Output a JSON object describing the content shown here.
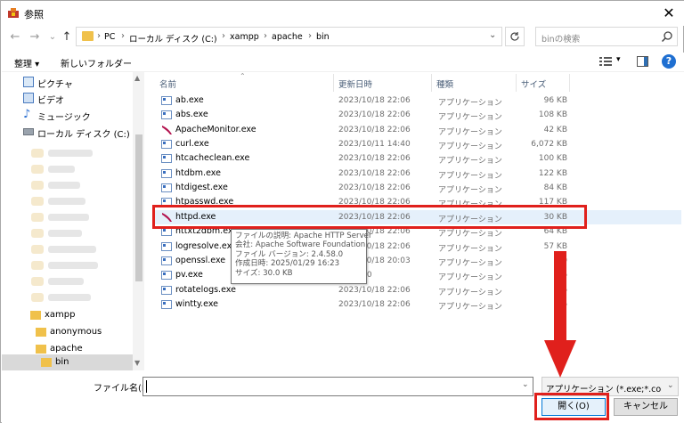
{
  "window": {
    "title": "参照",
    "close_glyph": "✕"
  },
  "nav_buttons": {
    "back": "←",
    "forward": "→",
    "recent": "⌄",
    "up": "↑"
  },
  "address": {
    "crumbs": [
      "PC",
      "ローカル ディスク (C:)",
      "xampp",
      "apache",
      "bin"
    ],
    "separator": "›"
  },
  "search": {
    "placeholder": "binの検索"
  },
  "toolbar": {
    "organize": "整理 ▾",
    "new_folder": "新しいフォルダー",
    "help": "?"
  },
  "sidebar": {
    "items": [
      {
        "label": "ピクチャ",
        "icon": "pictures-icon"
      },
      {
        "label": "ビデオ",
        "icon": "videos-icon"
      },
      {
        "label": "ミュージック",
        "icon": "music-icon"
      },
      {
        "label": "ローカル ディスク (C:)",
        "icon": "drive-icon"
      }
    ],
    "folders": [
      "xampp",
      "anonymous",
      "apache",
      "bin"
    ]
  },
  "columns": {
    "name": "名前",
    "modified": "更新日時",
    "type": "種類",
    "size": "サイズ"
  },
  "files": [
    {
      "name": "ab.exe",
      "date": "2023/10/18 22:06",
      "type": "アプリケーション",
      "size": "96 KB"
    },
    {
      "name": "abs.exe",
      "date": "2023/10/18 22:06",
      "type": "アプリケーション",
      "size": "108 KB"
    },
    {
      "name": "ApacheMonitor.exe",
      "date": "2023/10/18 22:06",
      "type": "アプリケーション",
      "size": "42 KB"
    },
    {
      "name": "curl.exe",
      "date": "2023/10/11 14:40",
      "type": "アプリケーション",
      "size": "6,072 KB"
    },
    {
      "name": "htcacheclean.exe",
      "date": "2023/10/18 22:06",
      "type": "アプリケーション",
      "size": "100 KB"
    },
    {
      "name": "htdbm.exe",
      "date": "2023/10/18 22:06",
      "type": "アプリケーション",
      "size": "122 KB"
    },
    {
      "name": "htdigest.exe",
      "date": "2023/10/18 22:06",
      "type": "アプリケーション",
      "size": "84 KB"
    },
    {
      "name": "htpasswd.exe",
      "date": "2023/10/18 22:06",
      "type": "アプリケーション",
      "size": "117 KB"
    },
    {
      "name": "httpd.exe",
      "date": "2023/10/18 22:06",
      "type": "アプリケーション",
      "size": "30 KB"
    },
    {
      "name": "httxt2dbm.exe",
      "date": "2023/10/18 22:06",
      "type": "アプリケーション",
      "size": "64 KB"
    },
    {
      "name": "logresolve.exe",
      "date": "2023/10/18 22:06",
      "type": "アプリケーション",
      "size": "57 KB"
    },
    {
      "name": "openssl.exe",
      "date": "2023/10/18 20:03",
      "type": "アプリケーション",
      "size": "70"
    },
    {
      "name": "pv.exe",
      "date": "/17 2:30",
      "type": "アプリケーション",
      "size": "6"
    },
    {
      "name": "rotatelogs.exe",
      "date": "2023/10/18 22:06",
      "type": "アプリケーション",
      "size": "6"
    },
    {
      "name": "wintty.exe",
      "date": "2023/10/18 22:06",
      "type": "アプリケーション",
      "size": "6"
    }
  ],
  "tooltip": {
    "lines": [
      "ファイルの説明: Apache HTTP Server",
      "会社: Apache Software Foundation",
      "ファイル バージョン: 2.4.58.0",
      "作成日時: 2025/01/29 16:23",
      "サイズ: 30.0 KB"
    ]
  },
  "bottom": {
    "filename_label": "ファイル名(N):",
    "filename_value": "",
    "filter": "アプリケーション (*.exe;*.com;*.icd",
    "open": "開く(O)",
    "cancel": "キャンセル"
  },
  "colors": {
    "highlight": "#e0201c",
    "selection": "#e5f0fb",
    "accent": "#0078d7"
  }
}
